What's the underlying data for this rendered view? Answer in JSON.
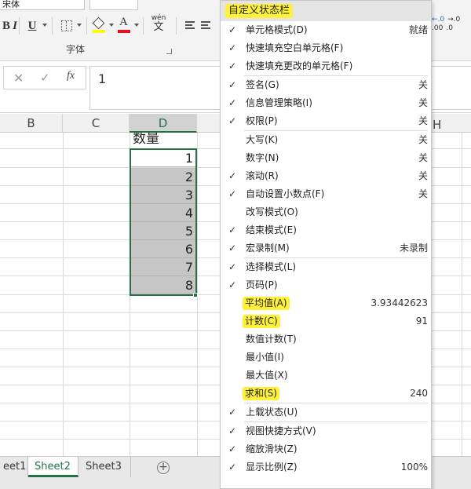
{
  "ribbon": {
    "font_name_partial": "宋体",
    "font_group_label": "字体",
    "wen_label_top": "wén",
    "wen_label_bottom": "文",
    "bold": "B",
    "italic": "I",
    "underline": "U",
    "font_color_letter": "A",
    "decimal_icons": [
      ".0",
      "←.0",
      ".00",
      "→.0"
    ]
  },
  "formula_bar": {
    "cancel": "✕",
    "enter": "✓",
    "fx": "fx",
    "value": "1"
  },
  "columns": [
    {
      "label": "B",
      "selected": false
    },
    {
      "label": "C",
      "selected": false
    },
    {
      "label": "D",
      "selected": true
    },
    {
      "label": "H",
      "selected": false
    }
  ],
  "cells": {
    "header": "数量",
    "values": [
      "1",
      "2",
      "3",
      "4",
      "5",
      "6",
      "7",
      "8"
    ]
  },
  "sheets": [
    {
      "label": "eet1",
      "active": false
    },
    {
      "label": "Sheet2",
      "active": true
    },
    {
      "label": "Sheet3",
      "active": false
    }
  ],
  "add_sheet": "+",
  "menu": {
    "title": "自定义状态栏",
    "items": [
      {
        "label": "单元格模式(D)",
        "checked": true,
        "value": "就绪",
        "highlight": false
      },
      {
        "label": "快速填充空白单元格(F)",
        "checked": true,
        "value": "",
        "highlight": false
      },
      {
        "label": "快速填充更改的单元格(F)",
        "checked": true,
        "value": "",
        "highlight": false,
        "sep_after": true
      },
      {
        "label": "签名(G)",
        "checked": true,
        "value": "关",
        "highlight": false
      },
      {
        "label": "信息管理策略(I)",
        "checked": true,
        "value": "关",
        "highlight": false
      },
      {
        "label": "权限(P)",
        "checked": true,
        "value": "关",
        "highlight": false,
        "sep_after": true
      },
      {
        "label": "大写(K)",
        "checked": false,
        "value": "关",
        "highlight": false
      },
      {
        "label": "数字(N)",
        "checked": false,
        "value": "关",
        "highlight": false
      },
      {
        "label": "滚动(R)",
        "checked": true,
        "value": "关",
        "highlight": false
      },
      {
        "label": "自动设置小数点(F)",
        "checked": true,
        "value": "关",
        "highlight": false
      },
      {
        "label": "改写模式(O)",
        "checked": false,
        "value": "",
        "highlight": false
      },
      {
        "label": "结束模式(E)",
        "checked": true,
        "value": "",
        "highlight": false
      },
      {
        "label": "宏录制(M)",
        "checked": true,
        "value": "未录制",
        "highlight": false,
        "sep_after": true
      },
      {
        "label": "选择模式(L)",
        "checked": true,
        "value": "",
        "highlight": false
      },
      {
        "label": "页码(P)",
        "checked": true,
        "value": "",
        "highlight": false
      },
      {
        "label": "平均值(A)",
        "checked": false,
        "value": "3.93442623",
        "highlight": true
      },
      {
        "label": "计数(C)",
        "checked": false,
        "value": "91",
        "highlight": true
      },
      {
        "label": "数值计数(T)",
        "checked": false,
        "value": "",
        "highlight": false
      },
      {
        "label": "最小值(I)",
        "checked": false,
        "value": "",
        "highlight": false
      },
      {
        "label": "最大值(X)",
        "checked": false,
        "value": "",
        "highlight": false
      },
      {
        "label": "求和(S)",
        "checked": false,
        "value": "240",
        "highlight": true,
        "sep_after": true
      },
      {
        "label": "上载状态(U)",
        "checked": true,
        "value": "",
        "highlight": false,
        "sep_after": true
      },
      {
        "label": "视图快捷方式(V)",
        "checked": true,
        "value": "",
        "highlight": false
      },
      {
        "label": "缩放滑块(Z)",
        "checked": true,
        "value": "",
        "highlight": false
      },
      {
        "label": "显示比例(Z)",
        "checked": true,
        "value": "100%",
        "highlight": false
      }
    ]
  },
  "colors": {
    "accent_green": "#217346",
    "highlight_yellow": "#fff13a",
    "selection_gray": "#c6c6c6"
  }
}
